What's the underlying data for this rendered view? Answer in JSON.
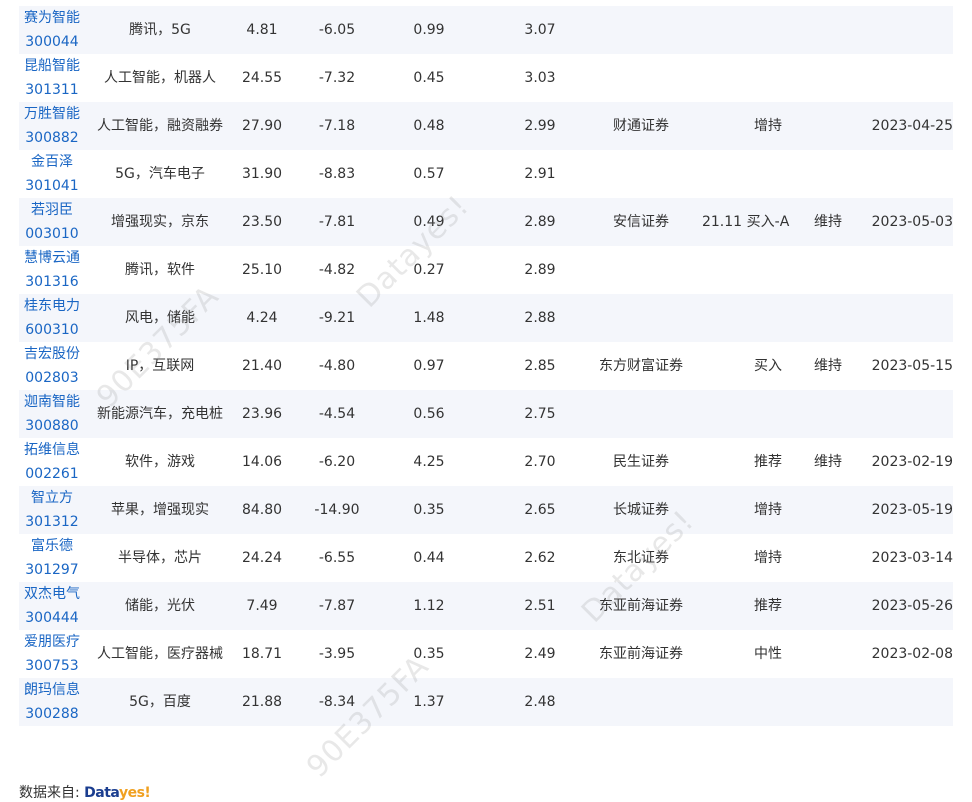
{
  "rows": [
    {
      "name": "赛为智能",
      "code": "300044",
      "concept": "腾讯，5G",
      "price": "4.81",
      "change": "-6.05",
      "turnover": "0.99",
      "score": "3.07",
      "broker": "",
      "target": "",
      "rating": "",
      "rating_change": "",
      "date": ""
    },
    {
      "name": "昆船智能",
      "code": "301311",
      "concept": "人工智能，机器人",
      "price": "24.55",
      "change": "-7.32",
      "turnover": "0.45",
      "score": "3.03",
      "broker": "",
      "target": "",
      "rating": "",
      "rating_change": "",
      "date": ""
    },
    {
      "name": "万胜智能",
      "code": "300882",
      "concept": "人工智能，融资融券",
      "price": "27.90",
      "change": "-7.18",
      "turnover": "0.48",
      "score": "2.99",
      "broker": "财通证券",
      "target": "",
      "rating": "增持",
      "rating_change": "",
      "date": "2023-04-25"
    },
    {
      "name": "金百泽",
      "code": "301041",
      "concept": "5G，汽车电子",
      "price": "31.90",
      "change": "-8.83",
      "turnover": "0.57",
      "score": "2.91",
      "broker": "",
      "target": "",
      "rating": "",
      "rating_change": "",
      "date": ""
    },
    {
      "name": "若羽臣",
      "code": "003010",
      "concept": "增强现实，京东",
      "price": "23.50",
      "change": "-7.81",
      "turnover": "0.49",
      "score": "2.89",
      "broker": "安信证券",
      "target": "21.11",
      "rating": "买入-A",
      "rating_change": "维持",
      "date": "2023-05-03"
    },
    {
      "name": "慧博云通",
      "code": "301316",
      "concept": "腾讯，软件",
      "price": "25.10",
      "change": "-4.82",
      "turnover": "0.27",
      "score": "2.89",
      "broker": "",
      "target": "",
      "rating": "",
      "rating_change": "",
      "date": ""
    },
    {
      "name": "桂东电力",
      "code": "600310",
      "concept": "风电，储能",
      "price": "4.24",
      "change": "-9.21",
      "turnover": "1.48",
      "score": "2.88",
      "broker": "",
      "target": "",
      "rating": "",
      "rating_change": "",
      "date": ""
    },
    {
      "name": "吉宏股份",
      "code": "002803",
      "concept": "IP，互联网",
      "price": "21.40",
      "change": "-4.80",
      "turnover": "0.97",
      "score": "2.85",
      "broker": "东方财富证券",
      "target": "",
      "rating": "买入",
      "rating_change": "维持",
      "date": "2023-05-15"
    },
    {
      "name": "迦南智能",
      "code": "300880",
      "concept": "新能源汽车，充电桩",
      "price": "23.96",
      "change": "-4.54",
      "turnover": "0.56",
      "score": "2.75",
      "broker": "",
      "target": "",
      "rating": "",
      "rating_change": "",
      "date": ""
    },
    {
      "name": "拓维信息",
      "code": "002261",
      "concept": "软件，游戏",
      "price": "14.06",
      "change": "-6.20",
      "turnover": "4.25",
      "score": "2.70",
      "broker": "民生证券",
      "target": "",
      "rating": "推荐",
      "rating_change": "维持",
      "date": "2023-02-19"
    },
    {
      "name": "智立方",
      "code": "301312",
      "concept": "苹果，增强现实",
      "price": "84.80",
      "change": "-14.90",
      "turnover": "0.35",
      "score": "2.65",
      "broker": "长城证券",
      "target": "",
      "rating": "增持",
      "rating_change": "",
      "date": "2023-05-19"
    },
    {
      "name": "富乐德",
      "code": "301297",
      "concept": "半导体，芯片",
      "price": "24.24",
      "change": "-6.55",
      "turnover": "0.44",
      "score": "2.62",
      "broker": "东北证券",
      "target": "",
      "rating": "增持",
      "rating_change": "",
      "date": "2023-03-14"
    },
    {
      "name": "双杰电气",
      "code": "300444",
      "concept": "储能，光伏",
      "price": "7.49",
      "change": "-7.87",
      "turnover": "1.12",
      "score": "2.51",
      "broker": "东亚前海证券",
      "target": "",
      "rating": "推荐",
      "rating_change": "",
      "date": "2023-05-26"
    },
    {
      "name": "爱朋医疗",
      "code": "300753",
      "concept": "人工智能，医疗器械",
      "price": "18.71",
      "change": "-3.95",
      "turnover": "0.35",
      "score": "2.49",
      "broker": "东亚前海证券",
      "target": "",
      "rating": "中性",
      "rating_change": "",
      "date": "2023-02-08"
    },
    {
      "name": "朗玛信息",
      "code": "300288",
      "concept": "5G，百度",
      "price": "21.88",
      "change": "-8.34",
      "turnover": "1.37",
      "score": "2.48",
      "broker": "",
      "target": "",
      "rating": "",
      "rating_change": "",
      "date": ""
    }
  ],
  "watermarks": [
    "Datayes!",
    "90E375FA",
    "Datayes!",
    "90E375FA"
  ],
  "source": {
    "label": "数据来自:",
    "logo_part1": "Data",
    "logo_part2": "yes!"
  }
}
